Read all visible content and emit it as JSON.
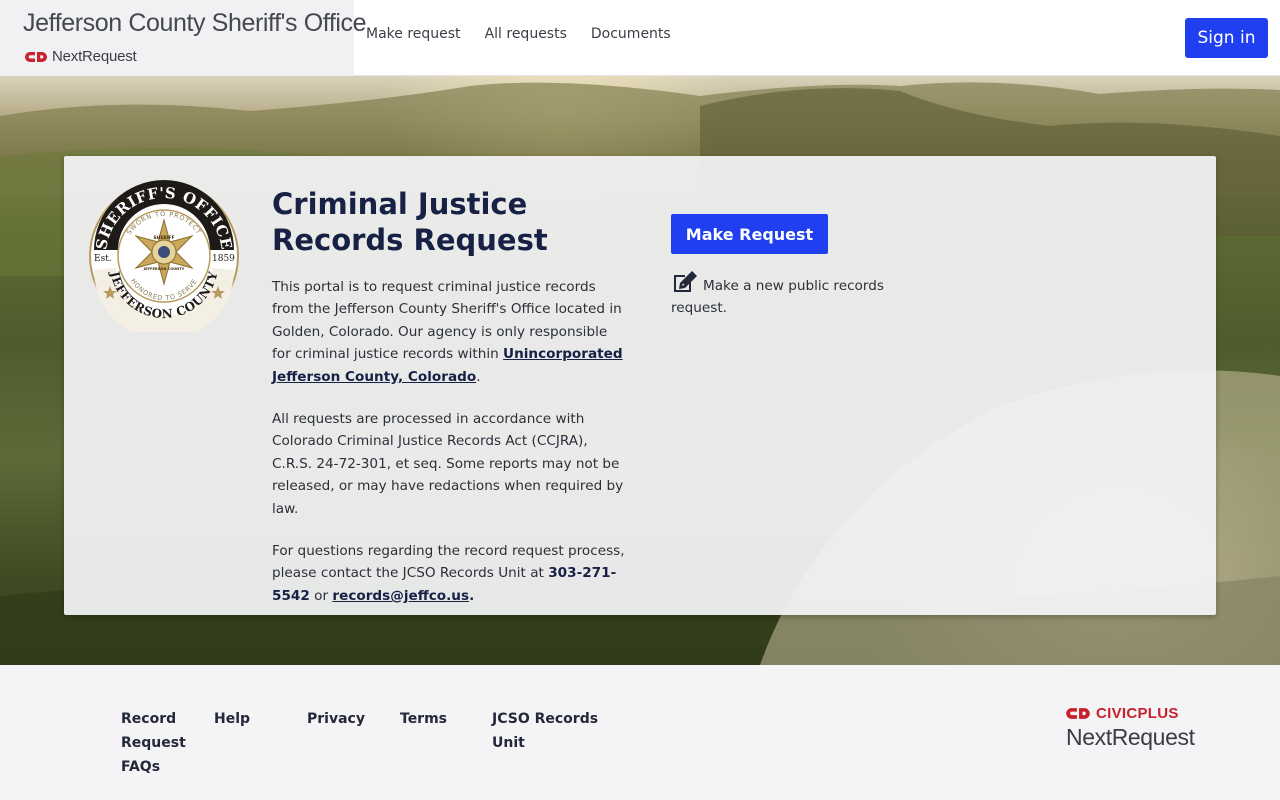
{
  "header": {
    "org_title": "Jefferson County Sheriff's Office",
    "product_name": "NextRequest",
    "nav": [
      {
        "label": "Make request"
      },
      {
        "label": "All requests"
      },
      {
        "label": "Documents"
      }
    ],
    "signin_label": "Sign in"
  },
  "seal": {
    "top_text": "SHERIFF'S OFFICE",
    "ribbon_text": "SWORN TO PROTECT",
    "est": "Est.",
    "year": "1859",
    "bottom_ribbon": "HONORED TO SERVE",
    "bottom_text": "JEFFERSON COUNTY",
    "badge_top": "SHERIFF",
    "badge_bottom": "JEFFERSON COUNTY"
  },
  "main": {
    "title_line1": "Criminal Justice",
    "title_line2": "Records Request",
    "p1_text": "This portal is to request criminal justice records from the Jefferson County Sheriff's Office located in Golden, Colorado. Our agency is only responsible for criminal justice records within ",
    "p1_link": "Unincorporated Jefferson County, Colorado",
    "p1_end": ".",
    "p2_text": "All requests are processed in accordance with Colorado Criminal Justice Records Act (CCJRA), C.R.S. 24-72-301, et seq. Some reports may not be released, or may have redactions when required by law.",
    "p3_text": "For questions regarding the record request process, please contact the JCSO Records Unit at ",
    "p3_phone": "303-271-5542",
    "p3_or": " or ",
    "p3_email": "records@jeffco.us",
    "p3_end": ".",
    "cta_label": "Make Request",
    "cta_desc": "Make a new public records request."
  },
  "footer": {
    "links": [
      {
        "label": "Record Request FAQs"
      },
      {
        "label": "Help"
      },
      {
        "label": "Privacy"
      },
      {
        "label": "Terms"
      },
      {
        "label": "JCSO Records Unit"
      }
    ],
    "brand_top": "CIVICPLUS",
    "brand_bottom": "NextRequest"
  },
  "colors": {
    "accent": "#1f3ff0",
    "navy": "#172145",
    "brand_red": "#c9202e"
  }
}
